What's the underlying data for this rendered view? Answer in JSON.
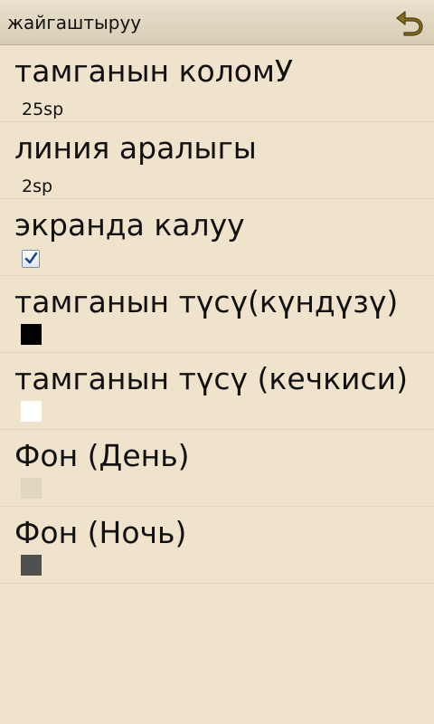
{
  "header": {
    "title": "жайгаштыруу",
    "back_icon": "back-arrow-icon",
    "accent": "#8a6d1e"
  },
  "settings": {
    "font_size": {
      "title": "тамганын коломУ",
      "value": "25sp"
    },
    "line_spacing": {
      "title": "линия аралыгы",
      "value": "2sp"
    },
    "keep_screen": {
      "title": "экранда калуу",
      "checked": true
    },
    "font_color_day": {
      "title": "тамганын түсү(күндүзү)",
      "color": "#000000"
    },
    "font_color_night": {
      "title": "тамганын түсү (кечкиси)",
      "color": "#ffffff"
    },
    "bg_day": {
      "title": "Фон (День)",
      "color": "#e0d7bf"
    },
    "bg_night": {
      "title": "Фон (Ночь)",
      "color": "#505050"
    }
  }
}
